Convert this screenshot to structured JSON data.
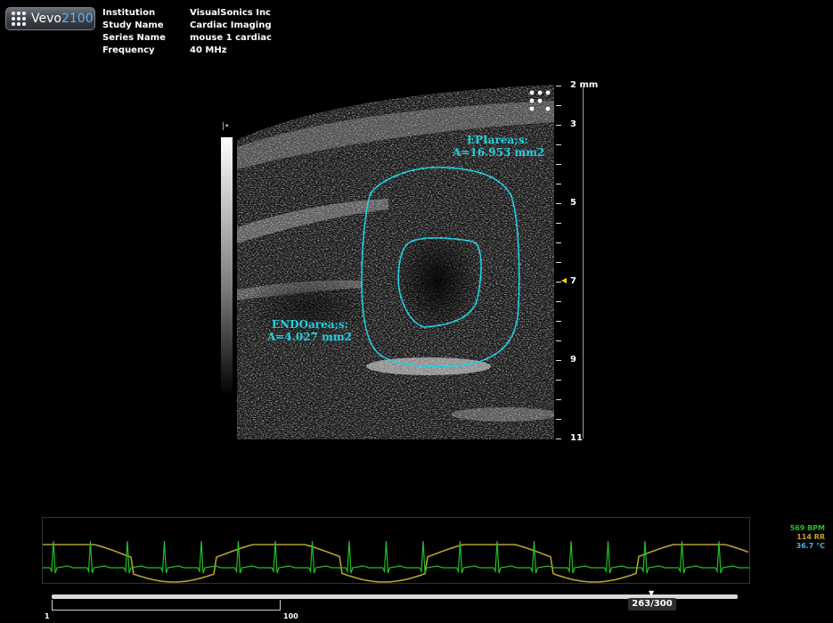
{
  "app": {
    "logo_prefix": "Vevo",
    "logo_suffix": "2100"
  },
  "info": [
    {
      "key": "Institution",
      "value": "VisualSonics Inc"
    },
    {
      "key": "Study Name",
      "value": "Cardiac Imaging"
    },
    {
      "key": "Series Name",
      "value": "mouse 1 cardiac"
    },
    {
      "key": "Frequency",
      "value": "40 MHz"
    }
  ],
  "scale": {
    "unit_label": "2 mm",
    "labels": [
      "3",
      "5",
      "7",
      "9",
      "11"
    ],
    "grayscale_marker": "|•"
  },
  "annotations": {
    "epi": {
      "name": "EPIarea;s:",
      "value": "A=16.953 mm2"
    },
    "endo": {
      "name": "ENDOarea;s:",
      "value": "A=4.027 mm2"
    }
  },
  "colors": {
    "trace": "#22d0e0",
    "ecg": "#22c022",
    "respiration": "#b8a030",
    "bpm": "#22c022",
    "rr": "#c8a020",
    "temp": "#4ab0e0"
  },
  "physio": {
    "bpm": "569 BPM",
    "rr": "114 RR",
    "temp": "36.7 °C"
  },
  "timeline": {
    "start": "1",
    "range_end": "100",
    "frame": "263/300"
  }
}
